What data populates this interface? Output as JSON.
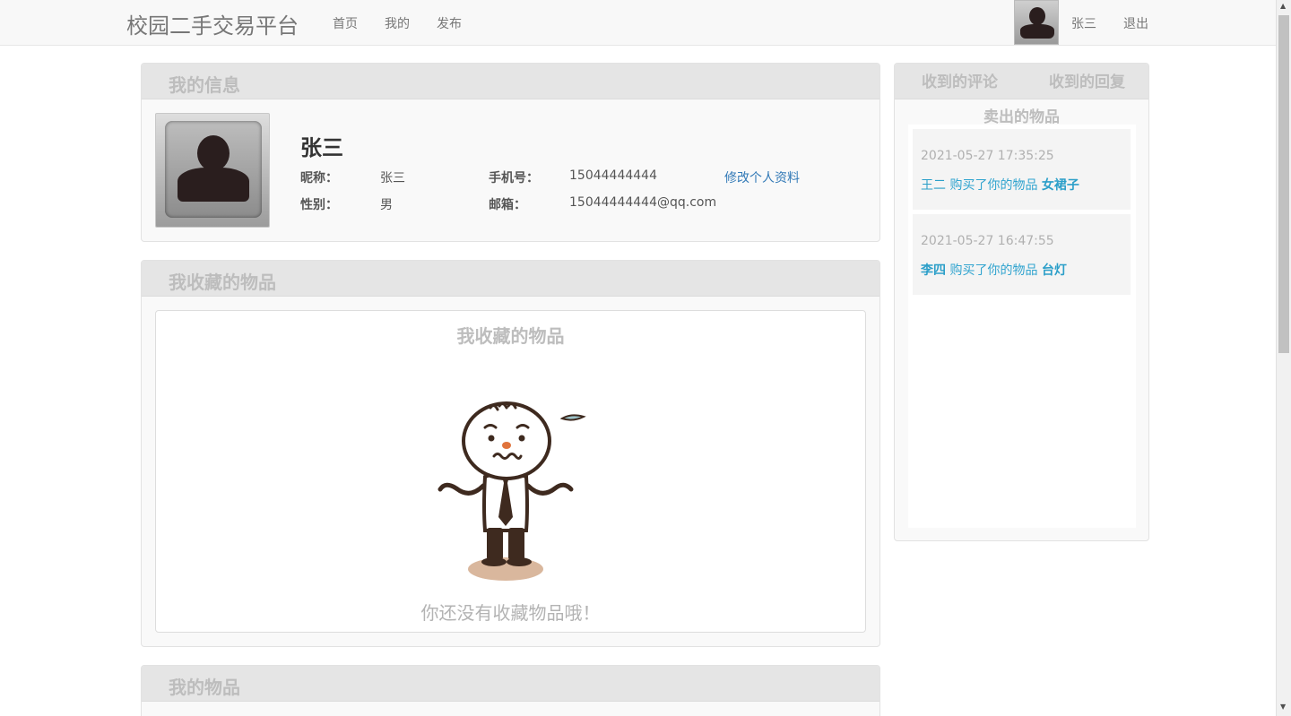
{
  "nav": {
    "brand": "校园二手交易平台",
    "links": [
      "首页",
      "我的",
      "发布"
    ],
    "username": "张三",
    "logout": "退出"
  },
  "info_panel": {
    "title": "我的信息",
    "name": "张三",
    "nickname_label": "昵称：",
    "nickname": "张三",
    "phone_label": "手机号：",
    "phone": "15044444444",
    "edit_link": "修改个人资料",
    "gender_label": "性别：",
    "gender": "男",
    "email_label": "邮箱：",
    "email": "15044444444@qq.com"
  },
  "favorites_panel": {
    "title": "我收藏的物品",
    "inner_title": "我收藏的物品",
    "empty_message": "你还没有收藏物品哦！"
  },
  "items_panel": {
    "title": "我的物品"
  },
  "side_panel": {
    "tabs": [
      "收到的评论",
      "收到的回复"
    ],
    "sold_title": "卖出的物品",
    "sales": [
      {
        "time": "2021-05-27 17:35:25",
        "buyer": "王二",
        "text": " 购买了你的物品 ",
        "product": "女裙子"
      },
      {
        "time": "2021-05-27 16:47:55",
        "buyer": "李四",
        "text": " 购买了你的物品 ",
        "product": "台灯"
      }
    ]
  },
  "colors": {
    "link": "#337ab7",
    "sale_text": "#31a4cf",
    "panel_head": "#e5e5e5",
    "muted_title": "#bdbdbd"
  },
  "icons": [
    "user-avatar-icon",
    "confused-cartoon-icon",
    "scroll-up-arrow-icon",
    "scroll-down-arrow-icon"
  ]
}
